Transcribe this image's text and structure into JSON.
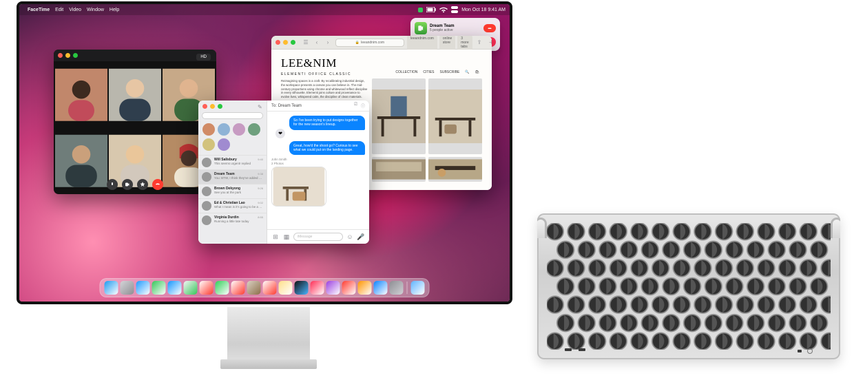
{
  "menubar": {
    "apple": "",
    "app": "FaceTime",
    "items": [
      "Edit",
      "Video",
      "Window",
      "Help"
    ],
    "status_time": "Mon Oct 18  9:41 AM"
  },
  "notification": {
    "title": "Dream Team",
    "subtitle": "5 people active"
  },
  "facetime": {
    "badge": "HD"
  },
  "messages": {
    "search_placeholder": "Search",
    "header_to": "To:",
    "header_name": "Dream Team",
    "compose_placeholder": "iMessage",
    "bubbles": {
      "out1": "So I've been trying to put designs together for the new season's lineup.",
      "out2": "Great, how'd the shoot go? Curious to see what we could put on the landing page.",
      "in_sender": "John Smith",
      "in_attach_label": "2 Photos"
    },
    "conversations": [
      {
        "name": "Will Salisbury",
        "preview": "This seems urgent! replied",
        "time": "9:40"
      },
      {
        "name": "Dream Team",
        "preview": "You: BTW, I think they've added her",
        "time": "9:38"
      },
      {
        "name": "Brown Dekyong",
        "preview": "See you at the park",
        "time": "9:26"
      },
      {
        "name": "Ed & Christian Lao",
        "preview": "What I mean is it's going to be a nice",
        "time": "9:02"
      },
      {
        "name": "Virginia Durdin",
        "preview": "Running a little late today",
        "time": "8:55"
      }
    ]
  },
  "safari": {
    "address": "leeandnim.com",
    "tabs": [
      {
        "label": "leeandnim.com"
      },
      {
        "label": "online store"
      },
      {
        "label": "3 more tabs"
      }
    ],
    "brand": "LEE&NIM",
    "nav": [
      "COLLECTION",
      "CITIES",
      "SUBSCRIBE"
    ],
    "crumb": "ELEMENTI  OFFICE CLASSIC",
    "blurb": "Reimagining spaces is a craft. By recalibrating industrial design, the workspace presents a canvas you can believe in. The mid-century proportions using chrome and whitewood reflect discipline in every silhouette. Elementi joins culture and provenance to evolve lives, whispered calm, the discipline of clean materials."
  },
  "dock": {
    "items": [
      {
        "name": "finder",
        "c1": "#1e9bf0",
        "c2": "#ffffff"
      },
      {
        "name": "launchpad",
        "c1": "#d4d4d8",
        "c2": "#8e8e93"
      },
      {
        "name": "safari",
        "c1": "#1f9bff",
        "c2": "#ffffff"
      },
      {
        "name": "messages",
        "c1": "#34c759",
        "c2": "#ffffff"
      },
      {
        "name": "mail",
        "c1": "#1597ff",
        "c2": "#ffffff"
      },
      {
        "name": "maps",
        "c1": "#f5f5f5",
        "c2": "#34c759"
      },
      {
        "name": "photos",
        "c1": "#ffffff",
        "c2": "#ff3b30"
      },
      {
        "name": "facetime",
        "c1": "#30d158",
        "c2": "#ffffff"
      },
      {
        "name": "calendar",
        "c1": "#ffffff",
        "c2": "#ff3b30"
      },
      {
        "name": "contacts",
        "c1": "#d9d1c2",
        "c2": "#8e6f4b"
      },
      {
        "name": "reminders",
        "c1": "#ffffff",
        "c2": "#ff3b30"
      },
      {
        "name": "notes",
        "c1": "#ffe08a",
        "c2": "#ffffff"
      },
      {
        "name": "tv",
        "c1": "#111",
        "c2": "#48b4ff"
      },
      {
        "name": "music",
        "c1": "#ff2d55",
        "c2": "#ffffff"
      },
      {
        "name": "podcasts",
        "c1": "#9b3fe0",
        "c2": "#ffffff"
      },
      {
        "name": "news",
        "c1": "#ff3b30",
        "c2": "#ffffff"
      },
      {
        "name": "books",
        "c1": "#ff9500",
        "c2": "#ffffff"
      },
      {
        "name": "appstore",
        "c1": "#0a84ff",
        "c2": "#ffffff"
      },
      {
        "name": "settings",
        "c1": "#8e8e93",
        "c2": "#d1d1d6"
      },
      {
        "name": "screenshot",
        "c1": "#5fb4ff",
        "c2": "#fff"
      }
    ]
  }
}
